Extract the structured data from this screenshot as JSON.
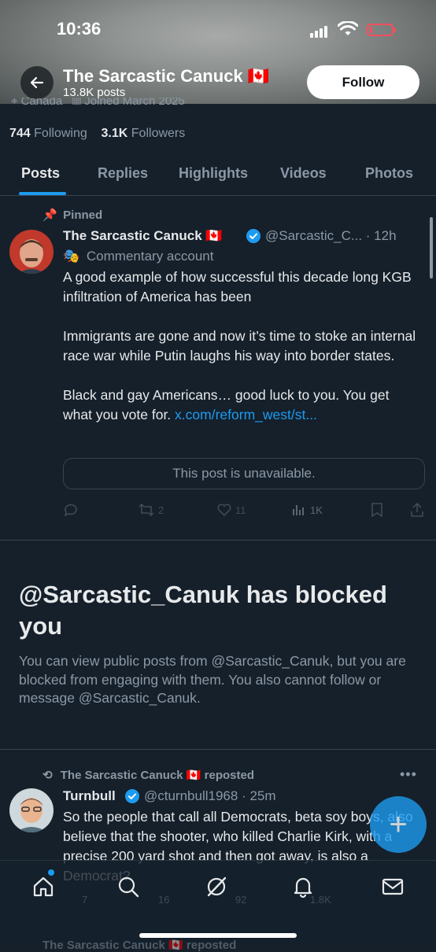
{
  "status_bar": {
    "time": "10:36"
  },
  "header": {
    "name": "The Sarcastic Canuck 🇨🇦",
    "posts_count": "13.8K posts",
    "follow_label": "Follow"
  },
  "profile": {
    "location": "Canada",
    "joined": "Joined March 2025",
    "following_count": "744",
    "following_label": "Following",
    "followers_count": "3.1K",
    "followers_label": "Followers"
  },
  "tabs": [
    "Posts",
    "Replies",
    "Highlights",
    "Videos",
    "Photos"
  ],
  "pinned_post": {
    "pinned_label": "Pinned",
    "author_name": "The Sarcastic Canuck 🇨🇦",
    "handle_time": "@Sarcastic_C... · 12h",
    "account_label": "Commentary account",
    "text_para1": "A good example of how successful this decade long KGB infiltration of America has been",
    "text_para2": "Immigrants are gone and now it’s time to stoke an internal race war while Putin laughs his way into border states.",
    "text_para3": "Black and gay Americans… good luck to you. You get what you vote for.",
    "link_text": "x.com/reform_west/st...",
    "unavailable_text": "This post is unavailable.",
    "reposts": "2",
    "likes": "11",
    "views": "1K"
  },
  "blocked_notice": {
    "title": "@Sarcastic_Canuk has blocked you",
    "body": "You can view public posts from @Sarcastic_Canuk, but you are blocked from engaging with them. You also cannot follow or message @Sarcastic_Canuk."
  },
  "repost": {
    "repost_label": "The Sarcastic Canuck 🇨🇦 reposted",
    "author_name": "Turnbull",
    "handle_time": "@cturnbull1968 · 25m",
    "text": "So the people that call all Democrats, beta soy boys, also believe that the shooter, who killed Charlie Kirk, with a precise 200 yard shot and then got away, is also a Democrat?",
    "replies": "7",
    "reposts": "16",
    "likes": "92",
    "views": "1.8K"
  },
  "bottom_peek": {
    "repost_label": "The Sarcastic Canuck 🇨🇦 reposted"
  },
  "colors": {
    "background": "#15202b",
    "accent": "#1d9bf0",
    "secondary_text": "#8b98a5",
    "verified": "#1d9bf0"
  },
  "icons": [
    "back-arrow-icon",
    "location-icon",
    "calendar-icon",
    "pin-icon",
    "verified-badge-icon",
    "commentary-icon",
    "reply-icon",
    "repost-icon",
    "like-icon",
    "views-icon",
    "bookmark-icon",
    "share-icon",
    "home-icon",
    "search-icon",
    "grok-icon",
    "bell-icon",
    "mail-icon",
    "compose-plus-icon"
  ]
}
